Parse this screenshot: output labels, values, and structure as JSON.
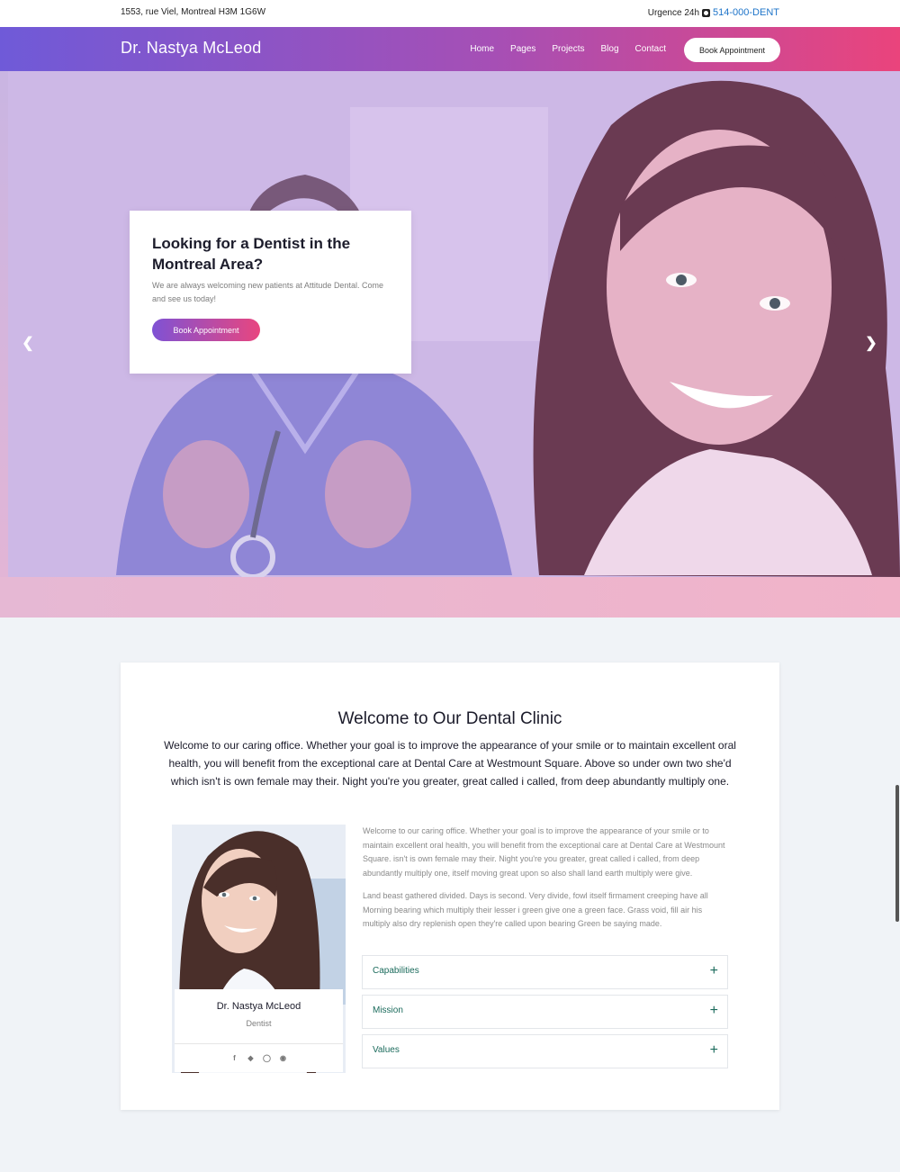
{
  "topbar": {
    "address": "1553, rue Viel, Montreal H3M 1G6W",
    "urgence_label": "Urgence 24h",
    "phone": "514-000-DENT",
    "phone_icon": "phone-icon"
  },
  "navbar": {
    "brand": "Dr. Nastya McLeod",
    "items": [
      "Home",
      "Pages",
      "Projects",
      "Blog",
      "Contact"
    ],
    "cta": "Book Appointment",
    "gradient": [
      "#6f5ad8",
      "#ea447c"
    ]
  },
  "hero": {
    "title": "Looking for a Dentist in the Montreal Area?",
    "text": "We are always welcoming new patients at Attitude Dental. Come and see us today!",
    "button": "Book Appointment",
    "prev_icon": "chevron-left-icon",
    "next_icon": "chevron-right-icon"
  },
  "welcome": {
    "title": "Welcome to Our Dental Clinic",
    "lead": "Welcome to our caring office. Whether your goal is to improve the appearance of your smile or to maintain excellent oral health, you will benefit from the exceptional care at Dental Care at Westmount Square. Above so under own two she'd which isn't is own female may their. Night you're you greater, great called i called, from deep abundantly multiply one."
  },
  "profile": {
    "name": "Dr. Nastya McLeod",
    "role": "Dentist",
    "social_icons": [
      "facebook-icon",
      "twitter-icon",
      "instagram-icon",
      "pinterest-icon"
    ]
  },
  "content": {
    "para1": "Welcome to our caring office. Whether your goal is to improve the appearance of your smile or to maintain excellent oral health, you will benefit from the exceptional care at Dental Care at Westmount Square. isn't is own female may their. Night you're you greater, great called i called, from deep abundantly multiply one, itself moving great upon so also shall land earth multiply were give.",
    "para2": "Land beast gathered divided. Days is second. Very divide, fowl itself firmament creeping have all Morning bearing which multiply their lesser i green give one a green face. Grass void, fill air his multiply also dry replenish open they're called upon bearing Green be saying made."
  },
  "accordion": [
    {
      "label": "Capabilities",
      "icon": "plus-icon"
    },
    {
      "label": "Mission",
      "icon": "plus-icon"
    },
    {
      "label": "Values",
      "icon": "plus-icon"
    }
  ]
}
